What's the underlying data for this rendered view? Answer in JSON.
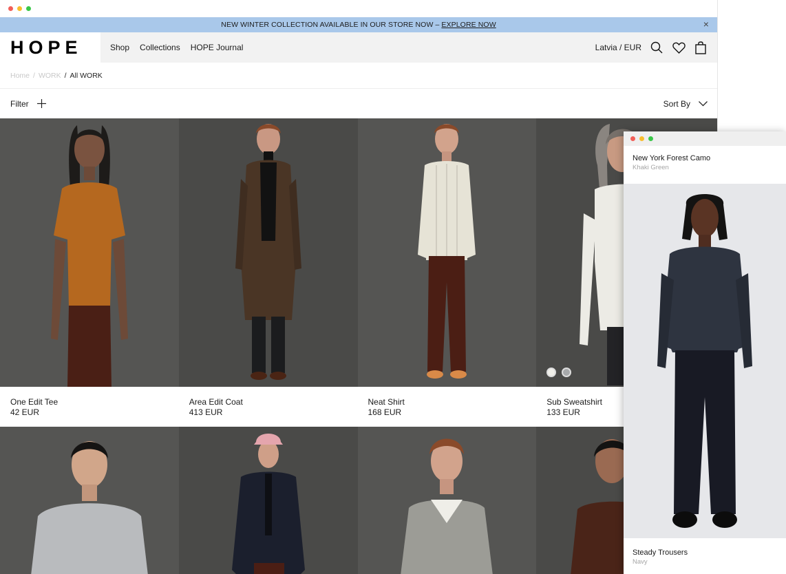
{
  "browser": {
    "controls": [
      "close",
      "minimize",
      "maximize"
    ]
  },
  "announcement": {
    "text": "NEW WINTER COLLECTION AVAILABLE IN OUR STORE NOW –",
    "link": "EXPLORE NOW",
    "close": "×"
  },
  "header": {
    "logo": "HOPE",
    "nav": [
      "Shop",
      "Collections",
      "HOPE Journal"
    ],
    "locale": "Latvia / EUR",
    "icons": [
      "search-icon",
      "heart-icon",
      "bag-icon"
    ]
  },
  "breadcrumb": {
    "home": "Home",
    "sep": "/",
    "section": "WORK",
    "current": "All WORK"
  },
  "toolbar": {
    "filter": "Filter",
    "sort": "Sort By"
  },
  "products_row1": [
    {
      "name": "One Edit Tee",
      "price": "42 EUR"
    },
    {
      "name": "Area Edit Coat",
      "price": "413 EUR"
    },
    {
      "name": "Neat Shirt",
      "price": "168 EUR"
    },
    {
      "name": "Sub Sweatshirt",
      "price": "133 EUR"
    }
  ],
  "overlay": {
    "title": "New York Forest Camo",
    "subtitle": "Khaki Green",
    "footer_title": "Steady Trousers",
    "footer_subtitle": "Navy"
  },
  "colors": {
    "announcement_bg": "#a9c8ea",
    "photo_bg": "#4a4a48",
    "overlay_photo_bg": "#e6e7ea"
  }
}
